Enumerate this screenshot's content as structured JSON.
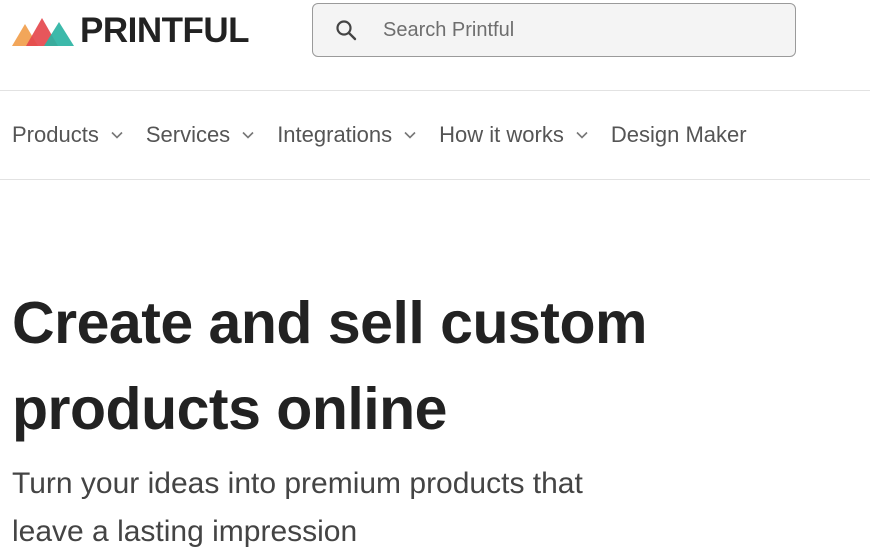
{
  "header": {
    "logo_text": "PRINTFUL",
    "logo_colors": [
      "#f2a65a",
      "#e5484d",
      "#2bb3a3"
    ],
    "search": {
      "placeholder": "Search Printful",
      "icon": "search-icon"
    }
  },
  "nav": {
    "items": [
      {
        "label": "Products",
        "has_dropdown": true
      },
      {
        "label": "Services",
        "has_dropdown": true
      },
      {
        "label": "Integrations",
        "has_dropdown": true
      },
      {
        "label": "How it works",
        "has_dropdown": true
      },
      {
        "label": "Design Maker",
        "has_dropdown": false
      }
    ]
  },
  "hero": {
    "title_line1": "Create and sell custom",
    "title_line2": "products online",
    "subtitle_line1": "Turn your ideas into premium products that",
    "subtitle_line2": "leave a lasting impression"
  }
}
